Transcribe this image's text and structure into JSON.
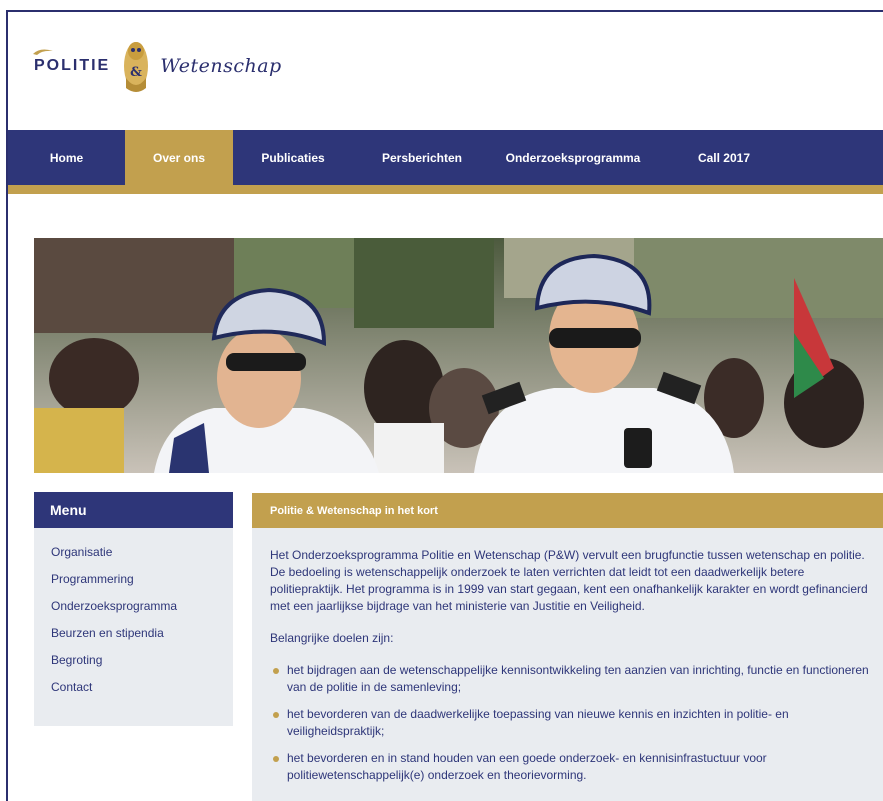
{
  "logo": {
    "word1": "POLITIE",
    "emblem_text": "&",
    "word2": "Wetenschap"
  },
  "nav": {
    "items": [
      {
        "label": "Home",
        "active": false
      },
      {
        "label": "Over ons",
        "active": true
      },
      {
        "label": "Publicaties",
        "active": false
      },
      {
        "label": "Persberichten",
        "active": false
      },
      {
        "label": "Onderzoeksprogramma",
        "active": false
      },
      {
        "label": "Call 2017",
        "active": false
      }
    ]
  },
  "hero": {
    "description_icon": "photo-cycling-police-officers"
  },
  "menu": {
    "title": "Menu",
    "items": [
      "Organisatie",
      "Programmering",
      "Onderzoeksprogramma",
      "Beurzen en stipendia",
      "Begroting",
      "Contact"
    ]
  },
  "content": {
    "title": "Politie & Wetenschap in het kort",
    "intro": "Het Onderzoeksprogramma Politie en Wetenschap (P&W) vervult een brugfunctie tussen wetenschap en politie. De bedoeling is wetenschappelijk onderzoek te laten verrichten dat leidt tot een daadwerkelijk betere politiepraktijk. Het programma is in 1999 van start gegaan, kent een onafhankelijk karakter en wordt gefinancierd met een jaarlijkse bijdrage van het ministerie van Justitie en Veiligheid.",
    "goals_heading": "Belangrijke doelen zijn:",
    "goals": [
      "het bijdragen aan de wetenschappelijke kennisontwikkeling ten aanzien van inrichting, functie en functioneren van de politie in de samenleving;",
      "het bevorderen van de daadwerkelijke toepassing van nieuwe kennis en inzichten in politie- en veiligheidspraktijk;",
      "het bevorderen en in stand houden van een goede onderzoek- en kennisinfrastuctuur voor politiewetenschappelijk(e) onderzoek en theorievorming."
    ]
  },
  "colors": {
    "navy": "#2e3679",
    "gold": "#c2a04e",
    "panel": "#e9ecf0"
  }
}
